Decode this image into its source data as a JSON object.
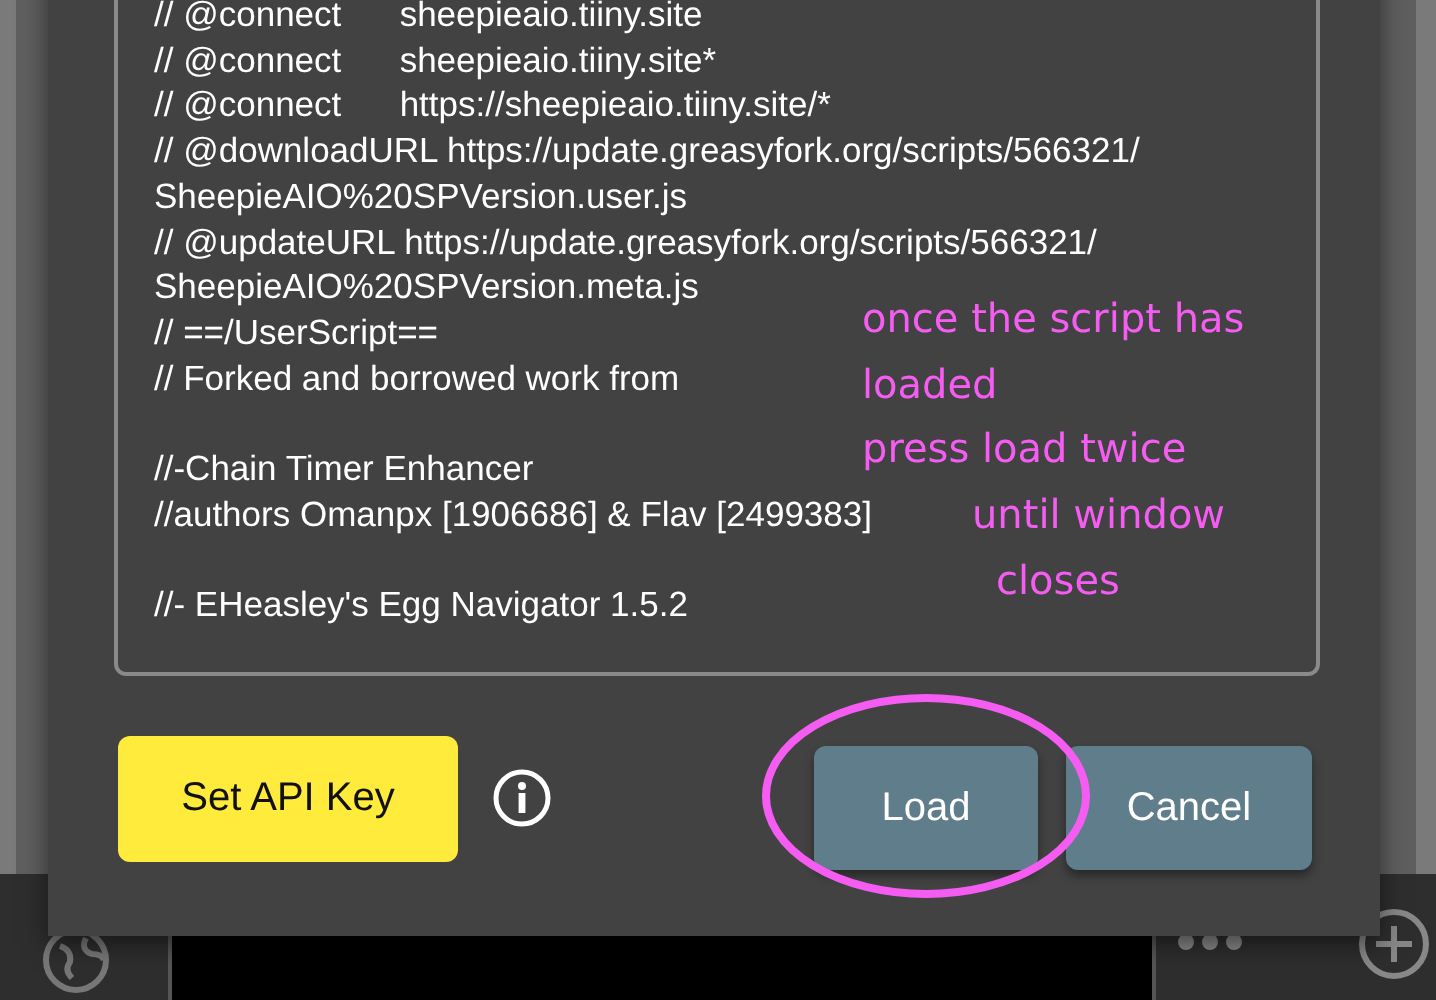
{
  "script_text": {
    "blocks": [
      [
        "// @connect      sheepieaio.tiiny.site",
        "// @connect      sheepieaio.tiiny.site*",
        "// @connect      https://sheepieaio.tiiny.site/*",
        "// @downloadURL https://update.greasyfork.org/scripts/566321/",
        "SheepieAIO%20SPVersion.user.js",
        "// @updateURL https://update.greasyfork.org/scripts/566321/",
        "SheepieAIO%20SPVersion.meta.js",
        "// ==/UserScript==",
        "// Forked and borrowed work from"
      ],
      [
        "//-Chain Timer Enhancer",
        "//authors Omanpx [1906686] & Flav [2499383]"
      ],
      [
        "//- EHeasley's Egg Navigator 1.5.2"
      ]
    ]
  },
  "buttons": {
    "set_api_key": "Set API Key",
    "load": "Load",
    "cancel": "Cancel"
  },
  "annotation": {
    "lines": [
      "once the script has",
      "loaded",
      "press load  twice",
      "until window",
      "closes"
    ]
  }
}
